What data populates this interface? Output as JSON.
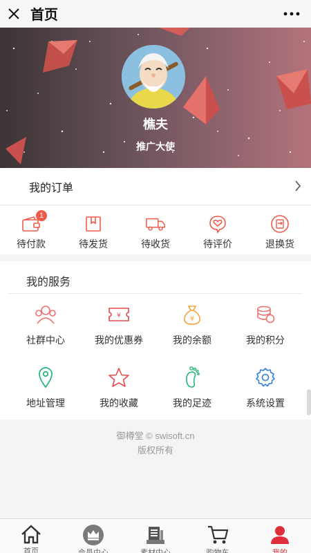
{
  "topbar": {
    "title": "首页",
    "close_icon": "close-icon",
    "more_icon": "more-icon"
  },
  "profile": {
    "nickname": "樵夫",
    "role": "推广大使"
  },
  "orders": {
    "label": "我的订单",
    "items": [
      {
        "label": "待付款",
        "icon": "wallet-icon",
        "badge": "1"
      },
      {
        "label": "待发货",
        "icon": "package-icon"
      },
      {
        "label": "待收货",
        "icon": "truck-icon"
      },
      {
        "label": "待评价",
        "icon": "heart-chat-icon"
      },
      {
        "label": "退换货",
        "icon": "return-icon"
      }
    ]
  },
  "services": {
    "heading": "我的服务",
    "items": [
      {
        "label": "社群中心",
        "icon": "community-icon"
      },
      {
        "label": "我的优惠券",
        "icon": "coupon-icon"
      },
      {
        "label": "我的余额",
        "icon": "money-bag-icon"
      },
      {
        "label": "我的积分",
        "icon": "coins-icon"
      },
      {
        "label": "地址管理",
        "icon": "location-icon"
      },
      {
        "label": "我的收藏",
        "icon": "star-icon"
      },
      {
        "label": "我的足迹",
        "icon": "footprint-icon"
      },
      {
        "label": "系统设置",
        "icon": "settings-icon"
      }
    ]
  },
  "footer": {
    "line1": "御樽堂 © swisoft.cn",
    "line2": "版权所有"
  },
  "tabbar": {
    "tabs": [
      {
        "label": "首页",
        "icon": "home-icon"
      },
      {
        "label": "会员中心",
        "icon": "crown-icon"
      },
      {
        "label": "素材中心",
        "icon": "materials-icon"
      },
      {
        "label": "购物车",
        "icon": "cart-icon"
      },
      {
        "label": "我的",
        "icon": "user-icon",
        "active": true
      }
    ]
  },
  "colors": {
    "accent": "#f05a4a",
    "coupon": "#e84a4a",
    "balance": "#f5a23a",
    "points": "#f07070",
    "address": "#27b87a",
    "footprint": "#27b87a",
    "settings": "#2f7fe0",
    "active_tab": "#e02f3c"
  }
}
